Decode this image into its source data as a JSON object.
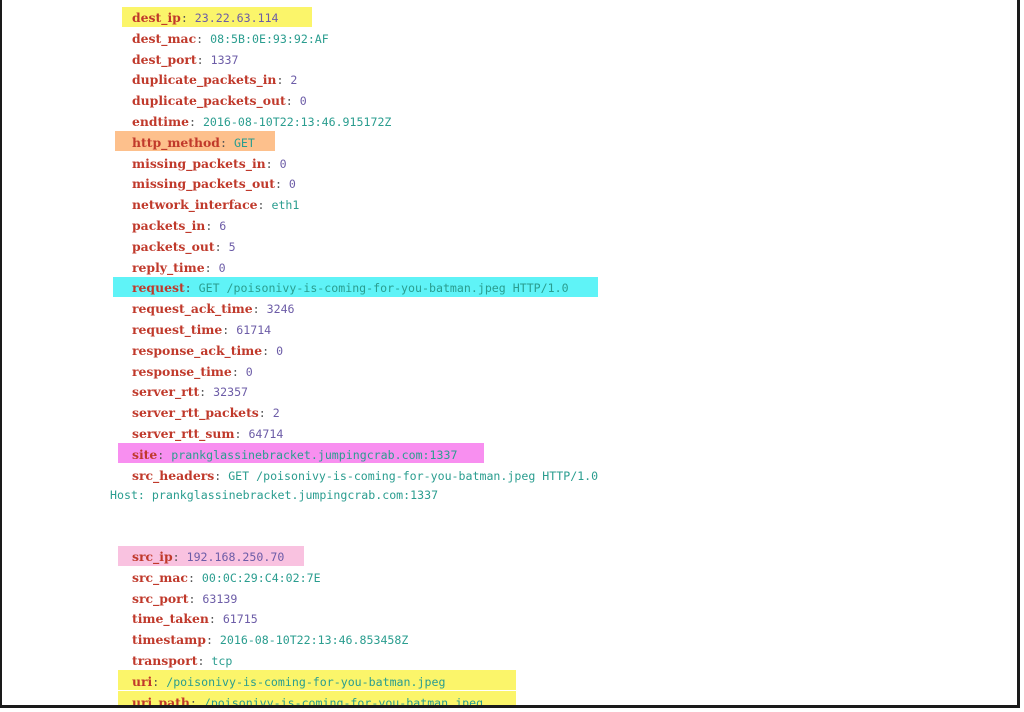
{
  "colors": {
    "key": "#c0392b",
    "string_value": "#2a9d8f",
    "number_value": "#6c5ca7",
    "highlight_yellow": "#fbf56a",
    "highlight_orange": "#fdc08c",
    "highlight_cyan": "#5ff3f7",
    "highlight_magenta": "#f88ff0",
    "highlight_pink": "#f9c2e0"
  },
  "fields": [
    {
      "key": "dest_ip",
      "value": "23.22.63.114",
      "type": "num",
      "highlight": "yellow"
    },
    {
      "key": "dest_mac",
      "value": "08:5B:0E:93:92:AF",
      "type": "str"
    },
    {
      "key": "dest_port",
      "value": "1337",
      "type": "num"
    },
    {
      "key": "duplicate_packets_in",
      "value": "2",
      "type": "num"
    },
    {
      "key": "duplicate_packets_out",
      "value": "0",
      "type": "num"
    },
    {
      "key": "endtime",
      "value": "2016-08-10T22:13:46.915172Z",
      "type": "str"
    },
    {
      "key": "http_method",
      "value": "GET",
      "type": "str",
      "highlight": "orange"
    },
    {
      "key": "missing_packets_in",
      "value": "0",
      "type": "num"
    },
    {
      "key": "missing_packets_out",
      "value": "0",
      "type": "num"
    },
    {
      "key": "network_interface",
      "value": "eth1",
      "type": "str"
    },
    {
      "key": "packets_in",
      "value": "6",
      "type": "num"
    },
    {
      "key": "packets_out",
      "value": "5",
      "type": "num"
    },
    {
      "key": "reply_time",
      "value": "0",
      "type": "num"
    },
    {
      "key": "request",
      "value": "GET /poisonivy-is-coming-for-you-batman.jpeg HTTP/1.0",
      "type": "str",
      "highlight": "cyan"
    },
    {
      "key": "request_ack_time",
      "value": "3246",
      "type": "num"
    },
    {
      "key": "request_time",
      "value": "61714",
      "type": "num"
    },
    {
      "key": "response_ack_time",
      "value": "0",
      "type": "num"
    },
    {
      "key": "response_time",
      "value": "0",
      "type": "num"
    },
    {
      "key": "server_rtt",
      "value": "32357",
      "type": "num"
    },
    {
      "key": "server_rtt_packets",
      "value": "2",
      "type": "num"
    },
    {
      "key": "server_rtt_sum",
      "value": "64714",
      "type": "num"
    },
    {
      "key": "site",
      "value": "prankglassinebracket.jumpingcrab.com:1337",
      "type": "str",
      "highlight": "magenta"
    },
    {
      "key": "src_headers",
      "value": "GET /poisonivy-is-coming-for-you-batman.jpeg HTTP/1.0",
      "type": "str"
    }
  ],
  "host_line": "Host: prankglassinebracket.jumpingcrab.com:1337",
  "fields_after": [
    {
      "key": "src_ip",
      "value": "192.168.250.70",
      "type": "num",
      "highlight": "pink"
    },
    {
      "key": "src_mac",
      "value": "00:0C:29:C4:02:7E",
      "type": "str"
    },
    {
      "key": "src_port",
      "value": "63139",
      "type": "num"
    },
    {
      "key": "time_taken",
      "value": "61715",
      "type": "num"
    },
    {
      "key": "timestamp",
      "value": "2016-08-10T22:13:46.853458Z",
      "type": "str"
    },
    {
      "key": "transport",
      "value": "tcp",
      "type": "str"
    },
    {
      "key": "uri",
      "value": "/poisonivy-is-coming-for-you-batman.jpeg",
      "type": "str",
      "highlight": "yellow"
    },
    {
      "key": "uri_path",
      "value": "/poisonivy-is-coming-for-you-batman.jpeg",
      "type": "str",
      "highlight": "yellow"
    }
  ]
}
